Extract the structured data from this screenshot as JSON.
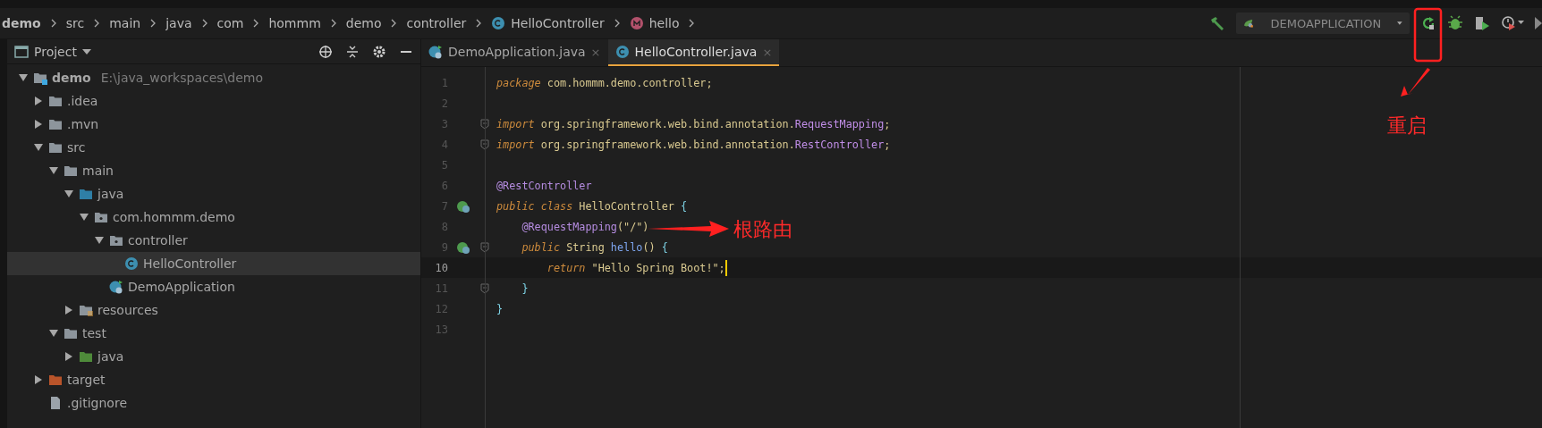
{
  "breadcrumb": [
    {
      "label": "demo",
      "kind": "module"
    },
    {
      "label": "src",
      "kind": "folder"
    },
    {
      "label": "main",
      "kind": "folder"
    },
    {
      "label": "java",
      "kind": "folder"
    },
    {
      "label": "com",
      "kind": "folder"
    },
    {
      "label": "hommm",
      "kind": "folder"
    },
    {
      "label": "demo",
      "kind": "folder"
    },
    {
      "label": "controller",
      "kind": "folder"
    },
    {
      "label": "HelloController",
      "kind": "class"
    },
    {
      "label": "hello",
      "kind": "method"
    }
  ],
  "run_config": {
    "label": "DEMOAPPLICATION"
  },
  "project_panel": {
    "title": "Project",
    "tree": [
      {
        "label": "demo",
        "path": "E:\\java_workspaces\\demo",
        "kind": "module",
        "expanded": true,
        "selected": false,
        "children": [
          {
            "label": ".idea",
            "kind": "folder",
            "expanded": false,
            "selected": false
          },
          {
            "label": ".mvn",
            "kind": "folder",
            "expanded": false,
            "selected": false
          },
          {
            "label": "src",
            "kind": "folder",
            "expanded": true,
            "selected": false,
            "children": [
              {
                "label": "main",
                "kind": "folder",
                "expanded": true,
                "selected": false,
                "children": [
                  {
                    "label": "java",
                    "kind": "source",
                    "expanded": true,
                    "selected": false,
                    "children": [
                      {
                        "label": "com.hommm.demo",
                        "kind": "package",
                        "expanded": true,
                        "selected": false,
                        "children": [
                          {
                            "label": "controller",
                            "kind": "package",
                            "expanded": true,
                            "selected": false,
                            "children": [
                              {
                                "label": "HelloController",
                                "kind": "class",
                                "selected": true
                              }
                            ]
                          },
                          {
                            "label": "DemoApplication",
                            "kind": "app",
                            "selected": false
                          }
                        ]
                      }
                    ]
                  },
                  {
                    "label": "resources",
                    "kind": "resources",
                    "expanded": false,
                    "selected": false
                  }
                ]
              },
              {
                "label": "test",
                "kind": "folder",
                "expanded": true,
                "selected": false,
                "children": [
                  {
                    "label": "java",
                    "kind": "test",
                    "expanded": false,
                    "selected": false
                  }
                ]
              }
            ]
          },
          {
            "label": "target",
            "kind": "excluded",
            "expanded": false,
            "selected": false
          },
          {
            "label": ".gitignore",
            "kind": "file",
            "selected": false
          }
        ]
      }
    ]
  },
  "tabs": [
    {
      "label": "DemoApplication.java",
      "kind": "app",
      "close": "×",
      "selected": false
    },
    {
      "label": "HelloController.java",
      "kind": "class",
      "close": "×",
      "selected": true
    }
  ],
  "code": [
    {
      "number": "1",
      "tokens": [
        {
          "text": "package",
          "kind": "keyword"
        },
        {
          "text": " com.hommm.demo.controller;",
          "kind": "plain"
        }
      ]
    },
    {
      "number": "2"
    },
    {
      "number": "3",
      "fold": true,
      "tokens": [
        {
          "text": "import",
          "kind": "keyword"
        },
        {
          "text": " org.springframework.web.bind.annotation.",
          "kind": "plain"
        },
        {
          "text": "RequestMapping",
          "kind": "type"
        },
        {
          "text": ";",
          "kind": "plain"
        }
      ]
    },
    {
      "number": "4",
      "fold": true,
      "tokens": [
        {
          "text": "import",
          "kind": "keyword"
        },
        {
          "text": " org.springframework.web.bind.annotation.",
          "kind": "plain"
        },
        {
          "text": "RestController",
          "kind": "type"
        },
        {
          "text": ";",
          "kind": "plain"
        }
      ]
    },
    {
      "number": "5"
    },
    {
      "number": "6",
      "tokens": [
        {
          "text": "@RestController",
          "kind": "annotation"
        }
      ]
    },
    {
      "number": "7",
      "bean": true,
      "tokens": [
        {
          "text": "public class",
          "kind": "keyword"
        },
        {
          "text": " HelloController ",
          "kind": "plain"
        },
        {
          "text": "{",
          "kind": "brace"
        }
      ]
    },
    {
      "number": "8",
      "tokens": [
        {
          "text": "    @RequestMapping",
          "kind": "annotation"
        },
        {
          "text": "(\"/\")",
          "kind": "plain"
        }
      ]
    },
    {
      "number": "9",
      "fold": true,
      "bean": true,
      "tokens": [
        {
          "text": "    public",
          "kind": "keyword"
        },
        {
          "text": " String ",
          "kind": "plain"
        },
        {
          "text": "hello",
          "kind": "method"
        },
        {
          "text": "() ",
          "kind": "plain"
        },
        {
          "text": "{",
          "kind": "brace"
        }
      ]
    },
    {
      "number": "10",
      "current": true,
      "tokens": [
        {
          "text": "        return",
          "kind": "keyword"
        },
        {
          "text": " \"Hello Spring Boot!\";",
          "kind": "plain"
        }
      ]
    },
    {
      "number": "11",
      "fold": true,
      "tokens": [
        {
          "text": "    }",
          "kind": "brace"
        }
      ]
    },
    {
      "number": "12",
      "tokens": [
        {
          "text": "}",
          "kind": "brace"
        }
      ]
    },
    {
      "number": "13"
    }
  ],
  "annotations": [
    {
      "text": "重启",
      "kind": "rerun"
    },
    {
      "text": "根路由",
      "kind": "route"
    }
  ]
}
